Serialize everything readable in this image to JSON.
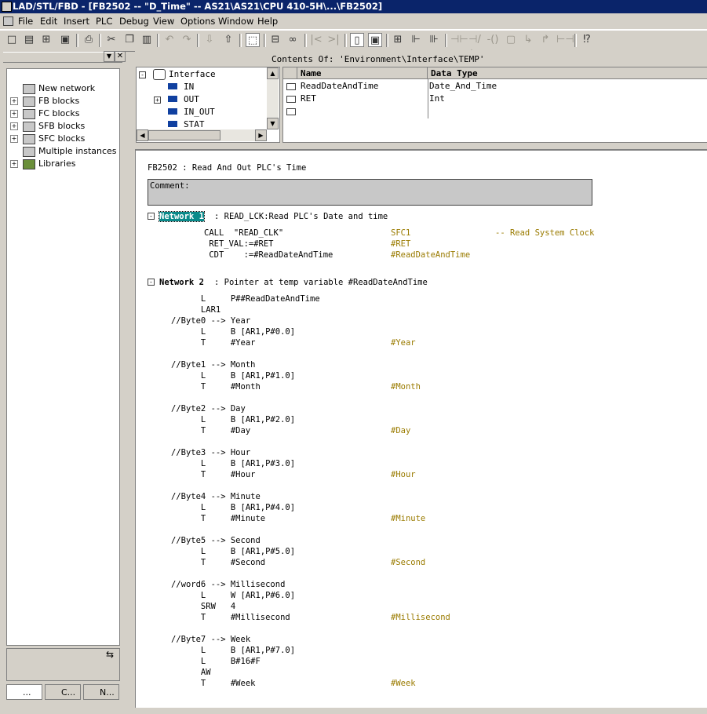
{
  "title": "LAD/STL/FBD  - [FB2502 -- \"D_Time\" -- AS21\\AS21\\CPU 410-5H\\...\\FB2502]",
  "menu": [
    "File",
    "Edit",
    "Insert",
    "PLC",
    "Debug",
    "View",
    "Options",
    "Window",
    "Help"
  ],
  "catalog": {
    "items": [
      {
        "label": "New network",
        "expand": ""
      },
      {
        "label": "FB blocks",
        "expand": "+"
      },
      {
        "label": "FC blocks",
        "expand": "+"
      },
      {
        "label": "SFB blocks",
        "expand": "+"
      },
      {
        "label": "SFC blocks",
        "expand": "+"
      },
      {
        "label": "Multiple instances",
        "expand": ""
      },
      {
        "label": "Libraries",
        "expand": "+"
      }
    ],
    "tabs": [
      "...",
      "C...",
      "N..."
    ]
  },
  "interface": {
    "root": "Interface",
    "items": [
      "IN",
      "OUT",
      "IN_OUT",
      "STAT"
    ],
    "contents_of": "Contents Of: 'Environment\\Interface\\TEMP'",
    "columns": {
      "name": "Name",
      "type": "Data Type"
    },
    "rows": [
      {
        "name": "ReadDateAndTime",
        "type": "Date_And_Time"
      },
      {
        "name": "RET",
        "type": "Int"
      }
    ]
  },
  "code": {
    "block_title": "FB2502 : Read And Out PLC's Time",
    "comment_label": "Comment:",
    "network1": {
      "label": "Network 1",
      "title": ": READ_LCK:Read PLC's Date and time"
    },
    "net1_lines": [
      {
        "code": "CALL  \"READ_CLK\"",
        "sym": "SFC1",
        "cmt": "-- Read System Clock"
      },
      {
        "code": " RET_VAL:=#RET",
        "sym": "#RET",
        "cmt": ""
      },
      {
        "code": " CDT    :=#ReadDateAndTime",
        "sym": "#ReadDateAndTime",
        "cmt": ""
      }
    ],
    "network2": {
      "label": "Network 2",
      "title": ": Pointer at temp variable #ReadDateAndTime"
    },
    "net2_lines": [
      {
        "c": "      L     P##ReadDateAndTime",
        "s": ""
      },
      {
        "c": "      LAR1",
        "s": ""
      },
      {
        "c": "//Byte0 --> Year",
        "s": ""
      },
      {
        "c": "      L     B [AR1,P#0.0]",
        "s": ""
      },
      {
        "c": "      T     #Year",
        "s": "#Year"
      },
      {
        "c": "",
        "s": ""
      },
      {
        "c": "//Byte1 --> Month",
        "s": ""
      },
      {
        "c": "      L     B [AR1,P#1.0]",
        "s": ""
      },
      {
        "c": "      T     #Month",
        "s": "#Month"
      },
      {
        "c": "",
        "s": ""
      },
      {
        "c": "//Byte2 --> Day",
        "s": ""
      },
      {
        "c": "      L     B [AR1,P#2.0]",
        "s": ""
      },
      {
        "c": "      T     #Day",
        "s": "#Day"
      },
      {
        "c": "",
        "s": ""
      },
      {
        "c": "//Byte3 --> Hour",
        "s": ""
      },
      {
        "c": "      L     B [AR1,P#3.0]",
        "s": ""
      },
      {
        "c": "      T     #Hour",
        "s": "#Hour"
      },
      {
        "c": "",
        "s": ""
      },
      {
        "c": "//Byte4 --> Minute",
        "s": ""
      },
      {
        "c": "      L     B [AR1,P#4.0]",
        "s": ""
      },
      {
        "c": "      T     #Minute",
        "s": "#Minute"
      },
      {
        "c": "",
        "s": ""
      },
      {
        "c": "//Byte5 --> Second",
        "s": ""
      },
      {
        "c": "      L     B [AR1,P#5.0]",
        "s": ""
      },
      {
        "c": "      T     #Second",
        "s": "#Second"
      },
      {
        "c": "",
        "s": ""
      },
      {
        "c": "//word6 --> Millisecond",
        "s": ""
      },
      {
        "c": "      L     W [AR1,P#6.0]",
        "s": ""
      },
      {
        "c": "      SRW   4",
        "s": ""
      },
      {
        "c": "      T     #Millisecond",
        "s": "#Millisecond"
      },
      {
        "c": "",
        "s": ""
      },
      {
        "c": "//Byte7 --> Week",
        "s": ""
      },
      {
        "c": "      L     B [AR1,P#7.0]",
        "s": ""
      },
      {
        "c": "      L     B#16#F",
        "s": ""
      },
      {
        "c": "      AW",
        "s": ""
      },
      {
        "c": "      T     #Week",
        "s": "#Week"
      }
    ]
  }
}
